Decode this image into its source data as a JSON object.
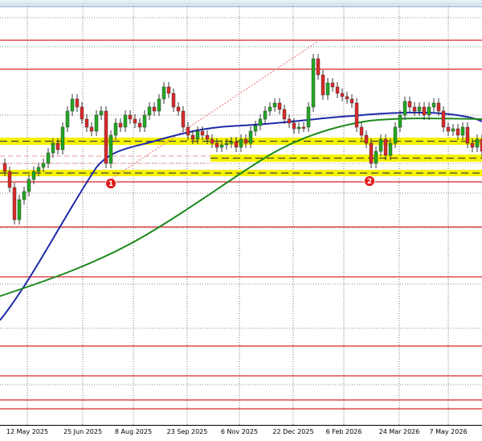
{
  "app": {
    "chart_area_color": "#ffffff"
  },
  "colors": {
    "grid": "#1a1a1a",
    "resistance": "#d9262b",
    "support_band": "#f5f200",
    "ma_100": "#1e2aa8",
    "ma_200": "#1e8a1e",
    "candle_up": "#22a822",
    "candle_down": "#d92b2b",
    "trendline": "#e07070",
    "marker": "#e01b1b"
  },
  "x_axis": {
    "labels": [
      "12 May 2025",
      "25 Jun 2025",
      "8 Aug 2025",
      "23 Sep 2025",
      "6 Nov 2025",
      "22 Dec 2025",
      "6 Feb 2026",
      "24 Mar 2026",
      "7 May 2026"
    ]
  },
  "markers": [
    {
      "label": "1"
    },
    {
      "label": "2"
    }
  ],
  "chart_data": {
    "type": "candlestick",
    "legend": "none",
    "grid": true,
    "overlays": [
      "100-bar moving average",
      "200-bar moving average",
      "support bands",
      "resistance lines",
      "trendline"
    ]
  }
}
